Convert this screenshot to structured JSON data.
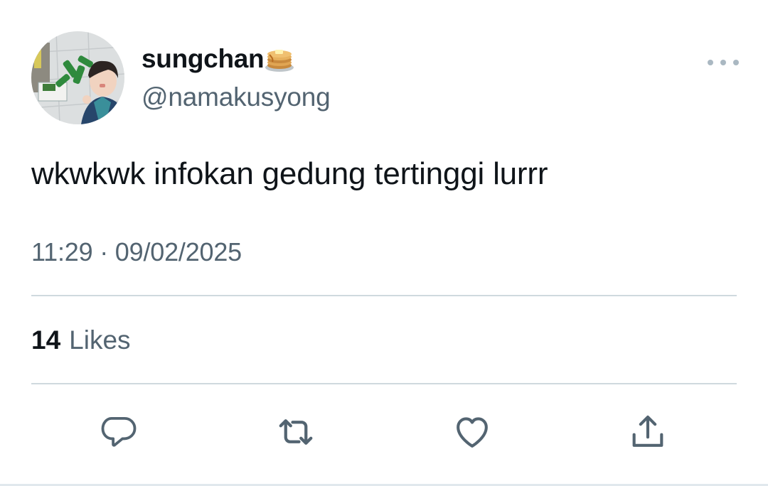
{
  "author": {
    "display_name": "sungchan",
    "name_emoji": "pancakes-emoji",
    "handle": "@namakusyong"
  },
  "tweet": {
    "text": "wkwkwk infokan gedung tertinggi lurrr",
    "timestamp": "11:29 · 09/02/2025"
  },
  "stats": {
    "likes_count": "14",
    "likes_label": "Likes"
  },
  "actions": [
    {
      "icon": "reply-icon"
    },
    {
      "icon": "retweet-icon"
    },
    {
      "icon": "heart-icon"
    },
    {
      "icon": "share-icon"
    }
  ],
  "colors": {
    "text_primary": "#0f1419",
    "text_secondary": "#536471",
    "icon": "#536471",
    "divider": "#cfd9de",
    "more_dots": "#aab8c2"
  }
}
